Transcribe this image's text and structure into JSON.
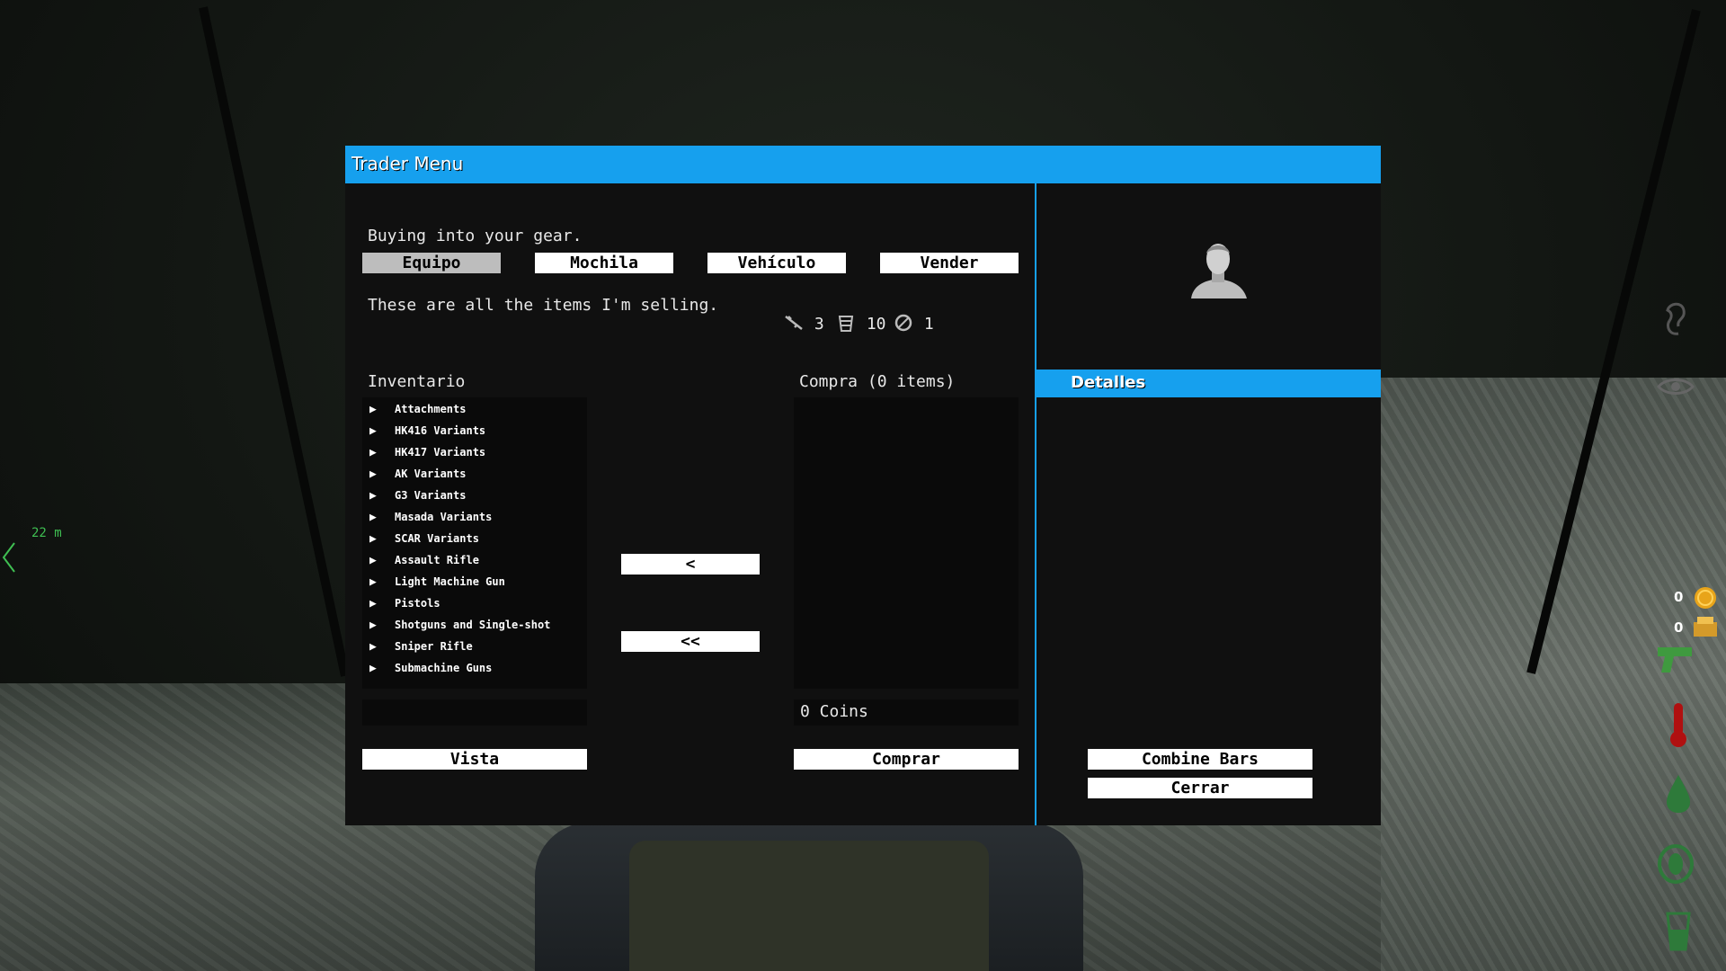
{
  "window": {
    "title": "Trader Menu"
  },
  "greeting": "Buying into your gear.",
  "tabs": [
    {
      "label": "Equipo",
      "active": true
    },
    {
      "label": "Mochila",
      "active": false
    },
    {
      "label": "Vehículo",
      "active": false
    },
    {
      "label": "Vender",
      "active": false
    }
  ],
  "description": "These are all the items I'm selling.",
  "capacity": [
    {
      "icon": "weapon-icon",
      "value": "3"
    },
    {
      "icon": "backpack-icon",
      "value": "10"
    },
    {
      "icon": "item-icon",
      "value": "1"
    }
  ],
  "inventory": {
    "title": "Inventario",
    "categories": [
      "Attachments",
      "HK416 Variants",
      "HK417 Variants",
      "AK Variants",
      "G3 Variants",
      "Masada Variants",
      "SCAR Variants",
      "Assault Rifle",
      "Light Machine Gun",
      "Pistols",
      "Shotguns and Single-shot",
      "Sniper Rifle",
      "Submachine Guns"
    ],
    "view_button": "Vista"
  },
  "transfer": {
    "remove_one": "<",
    "remove_all": "<<"
  },
  "purchase": {
    "title": "Compra (0 items)",
    "total": "0 Coins",
    "buy_button": "Comprar"
  },
  "details": {
    "title": "Detalles",
    "combine_button": "Combine Bars",
    "close_button": "Cerrar"
  },
  "hud": {
    "distance": "22 m",
    "coins": "0",
    "bank": "0",
    "accent": "#16a0ee"
  }
}
